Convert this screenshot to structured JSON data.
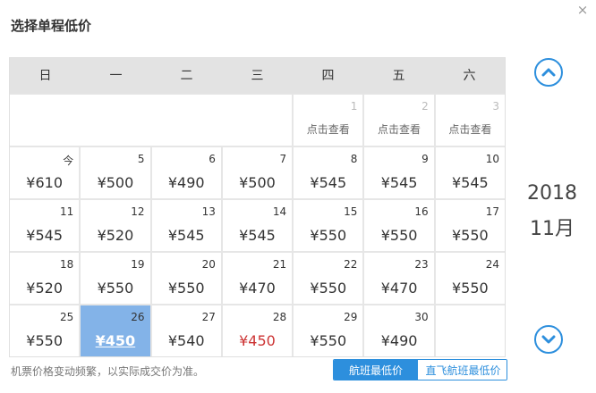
{
  "dialog": {
    "title": "选择单程低价",
    "close_label": "×"
  },
  "calendar": {
    "weekdays": [
      "日",
      "一",
      "二",
      "三",
      "四",
      "五",
      "六"
    ],
    "first_week_partial": [
      {
        "day": "1",
        "text": "点击查看"
      },
      {
        "day": "2",
        "text": "点击查看"
      },
      {
        "day": "3",
        "text": "点击查看"
      }
    ],
    "rows": [
      [
        {
          "day": "今",
          "price": "¥610"
        },
        {
          "day": "5",
          "price": "¥500"
        },
        {
          "day": "6",
          "price": "¥490"
        },
        {
          "day": "7",
          "price": "¥500"
        },
        {
          "day": "8",
          "price": "¥545"
        },
        {
          "day": "9",
          "price": "¥545"
        },
        {
          "day": "10",
          "price": "¥545"
        }
      ],
      [
        {
          "day": "11",
          "price": "¥545"
        },
        {
          "day": "12",
          "price": "¥520"
        },
        {
          "day": "13",
          "price": "¥545"
        },
        {
          "day": "14",
          "price": "¥545"
        },
        {
          "day": "15",
          "price": "¥550"
        },
        {
          "day": "16",
          "price": "¥550"
        },
        {
          "day": "17",
          "price": "¥550"
        }
      ],
      [
        {
          "day": "18",
          "price": "¥520"
        },
        {
          "day": "19",
          "price": "¥550"
        },
        {
          "day": "20",
          "price": "¥550"
        },
        {
          "day": "21",
          "price": "¥470"
        },
        {
          "day": "22",
          "price": "¥550"
        },
        {
          "day": "23",
          "price": "¥470"
        },
        {
          "day": "24",
          "price": "¥550"
        }
      ],
      [
        {
          "day": "25",
          "price": "¥550"
        },
        {
          "day": "26",
          "price": "¥450"
        },
        {
          "day": "27",
          "price": "¥540"
        },
        {
          "day": "28",
          "price": "¥450"
        },
        {
          "day": "29",
          "price": "¥550"
        },
        {
          "day": "30",
          "price": "¥490"
        }
      ]
    ],
    "selected_day": "26",
    "lowest_highlight_day": "28"
  },
  "side": {
    "year": "2018",
    "month": "11月",
    "prev_icon": "chevron-up-icon",
    "next_icon": "chevron-down-icon"
  },
  "footer": {
    "note": "机票价格变动频繁，以实际成交价为准。",
    "tab_active": "航班最低价",
    "tab_inactive": "直飞航班最低价"
  },
  "colors": {
    "accent": "#2d8fdd",
    "selected_bg": "#83b3e8",
    "price_red": "#cc3333"
  }
}
